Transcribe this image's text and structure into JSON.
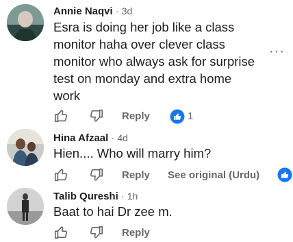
{
  "comments": [
    {
      "author": "Annie Naqvi",
      "time": "3d",
      "lines": [
        "Esra is doing her job like a class",
        "monitor haha over clever class",
        "monitor who always ask for surprise",
        "test on monday and extra home",
        "work"
      ],
      "reply_label": "Reply",
      "reaction_count": "1",
      "more_label": "···"
    },
    {
      "author": "Hina Afzaal",
      "time": "4d",
      "lines": [
        "Hien.... Who will marry him?"
      ],
      "reply_label": "Reply",
      "see_original": "See original (Urdu)"
    },
    {
      "author": "Talib Qureshi",
      "time": "1h",
      "lines": [
        "Baat to hai Dr zee m."
      ],
      "reply_label": "Reply"
    }
  ],
  "separator": "·",
  "colors": {
    "like_blue": "#1877f2",
    "meta_gray": "#65676b",
    "text": "#1c1e21"
  },
  "icons": [
    "like-outline-icon",
    "dislike-outline-icon",
    "like-reaction-icon",
    "more-options-icon"
  ]
}
